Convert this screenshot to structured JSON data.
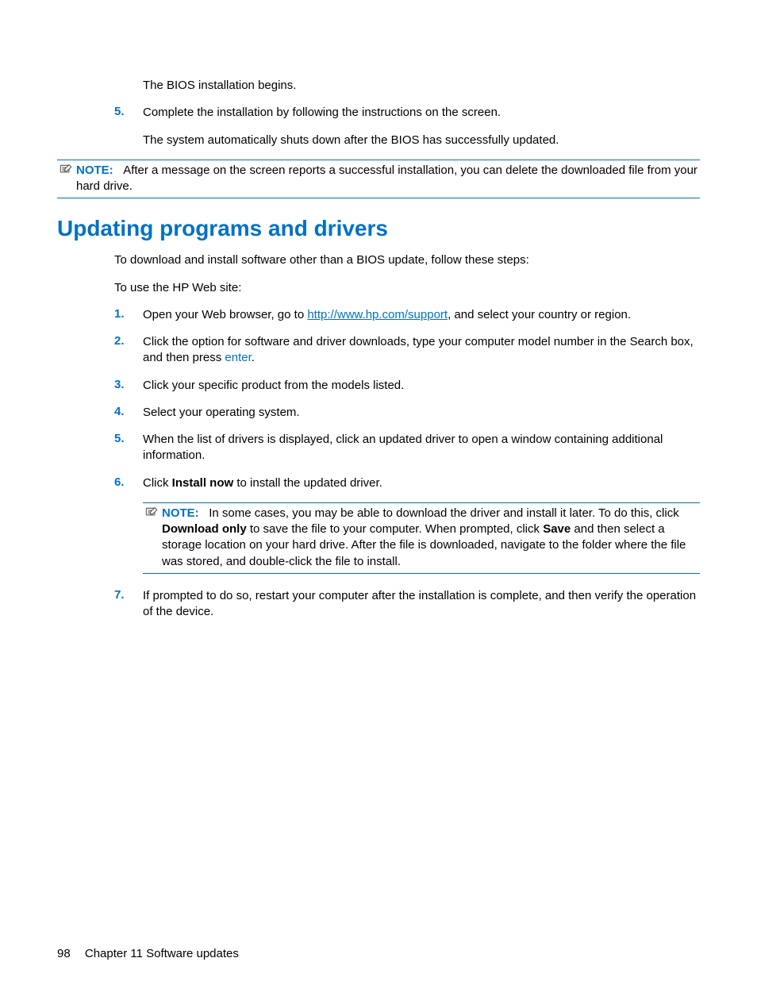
{
  "intro": {
    "line1": "The BIOS installation begins.",
    "step5_num": "5.",
    "step5_text": "Complete the installation by following the instructions on the screen.",
    "line2": "The system automatically shuts down after the BIOS has successfully updated."
  },
  "note1": {
    "label": "NOTE:",
    "text": "After a message on the screen reports a successful installation, you can delete the downloaded file from your hard drive."
  },
  "heading": "Updating programs and drivers",
  "para1": "To download and install software other than a BIOS update, follow these steps:",
  "para2": "To use the HP Web site:",
  "steps": {
    "s1_num": "1.",
    "s1_pre": "Open your Web browser, go to ",
    "s1_link": "http://www.hp.com/support",
    "s1_post": ", and select your country or region.",
    "s2_num": "2.",
    "s2_pre": "Click the option for software and driver downloads, type your computer model number in the Search box, and then press ",
    "s2_key": "enter",
    "s2_post": ".",
    "s3_num": "3.",
    "s3_text": "Click your specific product from the models listed.",
    "s4_num": "4.",
    "s4_text": "Select your operating system.",
    "s5_num": "5.",
    "s5_text": "When the list of drivers is displayed, click an updated driver to open a window containing additional information.",
    "s6_num": "6.",
    "s6_pre": "Click ",
    "s6_bold": "Install now",
    "s6_post": " to install the updated driver.",
    "s7_num": "7.",
    "s7_text": "If prompted to do so, restart your computer after the installation is complete, and then verify the operation of the device."
  },
  "note2": {
    "label": "NOTE:",
    "t1": "In some cases, you may be able to download the driver and install it later. To do this, click ",
    "b1": "Download only",
    "t2": " to save the file to your computer. When prompted, click ",
    "b2": "Save",
    "t3": " and then select a storage location on your hard drive. After the file is downloaded, navigate to the folder where the file was stored, and double-click the file to install."
  },
  "footer": {
    "page": "98",
    "chapter": "Chapter 11   Software updates"
  }
}
